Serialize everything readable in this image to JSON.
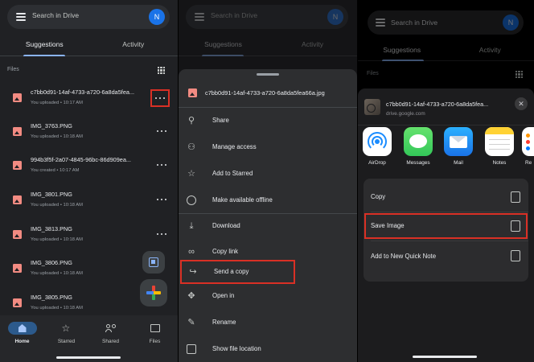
{
  "drive": {
    "search_placeholder": "Search in Drive",
    "avatar_initial": "N",
    "tabs": [
      "Suggestions",
      "Activity"
    ],
    "section_label": "Files",
    "files": [
      {
        "name": "c7bb0d91-14af-4733-a720-6a8da5fea...",
        "meta": "You uploaded • 10:17 AM"
      },
      {
        "name": "IMG_3763.PNG",
        "meta": "You uploaded • 10:18 AM"
      },
      {
        "name": "994b3f5f-2a07-4845-96bc-86d909ea...",
        "meta": "You created • 10:17 AM"
      },
      {
        "name": "IMG_3801.PNG",
        "meta": "You uploaded • 10:18 AM"
      },
      {
        "name": "IMG_3813.PNG",
        "meta": "You uploaded • 10:18 AM"
      },
      {
        "name": "IMG_3806.PNG",
        "meta": "You uploaded • 10:18 AM"
      },
      {
        "name": "IMG_3805.PNG",
        "meta": "You uploaded • 10:18 AM"
      }
    ],
    "bottom_nav": [
      "Home",
      "Starred",
      "Shared",
      "Files"
    ]
  },
  "menu": {
    "file_title": "c7bb0d91-14af-4733-a720-6a8da5fea66a.jpg",
    "items": [
      {
        "label": "Share",
        "icon": "add-person-icon"
      },
      {
        "label": "Manage access",
        "icon": "people-icon"
      },
      {
        "label": "Add to Starred",
        "icon": "star-icon"
      },
      {
        "label": "Make available offline",
        "icon": "offline-check-icon"
      },
      {
        "label": "Download",
        "icon": "download-icon"
      },
      {
        "label": "Copy link",
        "icon": "link-icon"
      },
      {
        "label": "Send a copy",
        "icon": "send-arrow-icon"
      },
      {
        "label": "Open in",
        "icon": "open-in-icon"
      },
      {
        "label": "Rename",
        "icon": "pencil-icon"
      },
      {
        "label": "Show file location",
        "icon": "folder-icon"
      }
    ]
  },
  "share_sheet": {
    "file_name": "c7bb0d91-14af-4733-a720-6a8da5fea...",
    "source": "drive.google.com",
    "apps": [
      "AirDrop",
      "Messages",
      "Mail",
      "Notes",
      "Re"
    ],
    "actions": [
      {
        "label": "Copy",
        "icon": "copy-icon"
      },
      {
        "label": "Save Image",
        "icon": "save-download-icon"
      },
      {
        "label": "Add to New Quick Note",
        "icon": "quick-note-icon"
      }
    ]
  },
  "colors": {
    "accent": "#8ab4f8",
    "highlight_box": "#d93025",
    "file_icon": "#f28b82"
  }
}
